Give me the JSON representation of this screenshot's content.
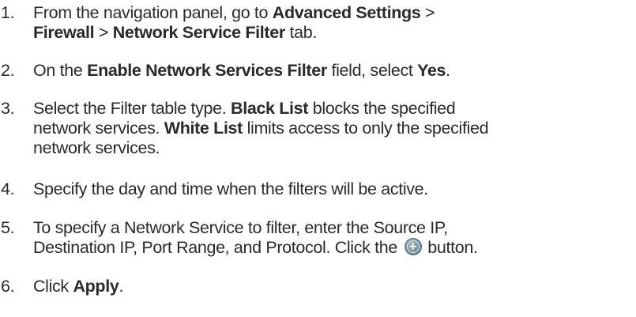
{
  "steps": [
    {
      "number": "1.",
      "line1": {
        "t1": "From the navigation panel, go to ",
        "b1": "Advanced Settings",
        "t2": " >"
      },
      "line2": {
        "b1": "Firewall",
        "t1": " > ",
        "b2": "Network Service Filter",
        "t2": " tab."
      }
    },
    {
      "number": "2.",
      "line1": {
        "t1": "On the ",
        "b1": "Enable Network Services Filter",
        "t2": " field, select ",
        "b2": "Yes",
        "t3": "."
      }
    },
    {
      "number": "3.",
      "line1": {
        "t1": "Select the Filter table type. ",
        "b1": "Black List",
        "t2": " blocks the specified"
      },
      "line2": {
        "t1": "network services. ",
        "b1": "White List",
        "t2": " limits access to only the specified"
      },
      "line3": {
        "t1": "network services."
      }
    },
    {
      "number": "4.",
      "line1": {
        "t1": "Specify the day and time when the filters will be active."
      }
    },
    {
      "number": "5.",
      "line1": {
        "t1": "To specify a Network Service to filter, enter the Source IP,"
      },
      "line2": {
        "t1": "Destination IP, Port Range, and Protocol. Click the",
        "t2": "button."
      },
      "icon": "add-circle-icon"
    },
    {
      "number": "6.",
      "line1": {
        "t1": "Click ",
        "b1": "Apply",
        "t2": "."
      }
    }
  ]
}
